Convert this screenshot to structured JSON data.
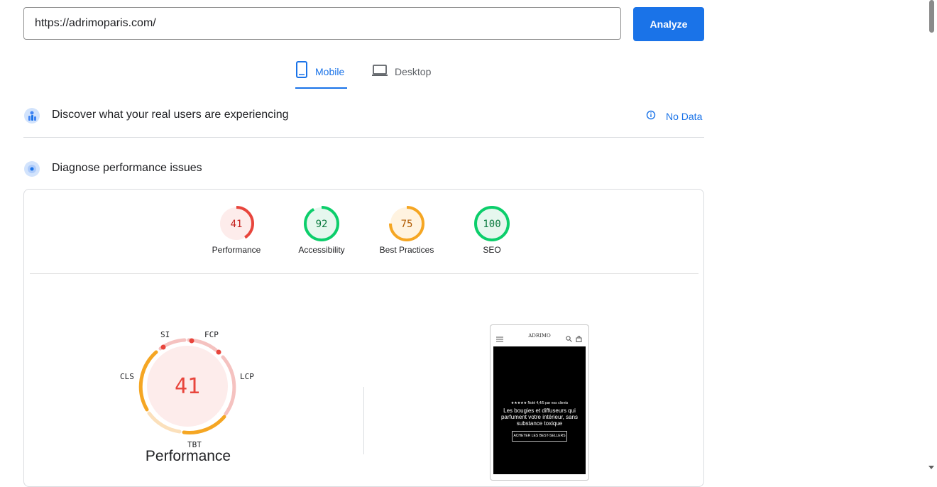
{
  "url_bar": {
    "value": "https://adrimoparis.com/",
    "analyze_label": "Analyze"
  },
  "tabs": [
    {
      "label": "Mobile",
      "active": true
    },
    {
      "label": "Desktop",
      "active": false
    }
  ],
  "field_data": {
    "title": "Discover what your real users are experiencing",
    "status": "No Data"
  },
  "diagnose": {
    "title": "Diagnose performance issues"
  },
  "scores": [
    {
      "label": "Performance",
      "value": "41",
      "color": "#e8453c"
    },
    {
      "label": "Accessibility",
      "value": "92",
      "color": "#0cce6b"
    },
    {
      "label": "Best Practices",
      "value": "75",
      "color": "#f5a623"
    },
    {
      "label": "SEO",
      "value": "100",
      "color": "#0cce6b"
    }
  ],
  "performance_gauge": {
    "score": "41",
    "title": "Performance",
    "metrics": [
      "SI",
      "FCP",
      "LCP",
      "CLS",
      "TBT"
    ]
  },
  "screenshot": {
    "logo": "ADRIMO",
    "rating": "★★★★★ Noté 4,4/5 par nos clients",
    "headline": "Les bougies et diffuseurs qui parfument votre intérieur, sans substance toxique",
    "cta": "ACHETER LES BEST-SELLERS"
  },
  "colors": {
    "accent": "#1a73e8",
    "fail": "#e8453c",
    "average": "#f5a623",
    "pass": "#0cce6b"
  }
}
